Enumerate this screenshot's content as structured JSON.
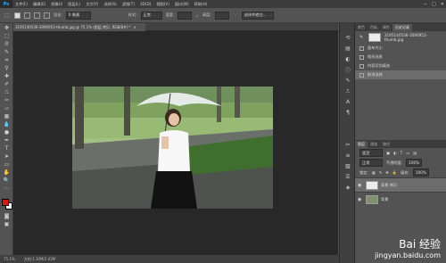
{
  "app": {
    "logo": "Ps",
    "menus": [
      "文件(F)",
      "编辑(E)",
      "图像(I)",
      "图层(L)",
      "文字(Y)",
      "选择(S)",
      "滤镜(T)",
      "3D(D)",
      "视图(V)",
      "窗口(W)",
      "帮助(H)"
    ],
    "window_controls": [
      "−",
      "□",
      "✕"
    ]
  },
  "options": {
    "feather_label": "羽化:",
    "feather_value": "0 像素",
    "style_label": "样式:",
    "style_value": "正常",
    "width_label": "宽度:",
    "height_label": "高度:",
    "select_mask": "选择并遮住..."
  },
  "document": {
    "tab_title": "3195140536-3090953-thumb.jpg @ 75.1% (图层 拷贝, RGB/8#) *",
    "close": "×",
    "zoom": "75.1%",
    "doc_info": "文档:1.10M/2.43M"
  },
  "panels": {
    "top_tabs": [
      "颜色",
      "色板",
      "属性",
      "历史记录"
    ],
    "history": [
      {
        "label": "3195140536-3090953-thumb.jpg",
        "selected": false,
        "snapshot": true
      },
      {
        "label": "画布大小",
        "selected": false
      },
      {
        "label": "矩形选框",
        "selected": false
      },
      {
        "label": "内容识别填充",
        "selected": false
      },
      {
        "label": "取消选择",
        "selected": true
      }
    ],
    "layer_tabs": [
      "图层",
      "通道",
      "路径"
    ],
    "layer_filter": "类型",
    "blend_mode": "正常",
    "opacity_label": "不透明度:",
    "opacity_value": "100%",
    "lock_label": "锁定:",
    "fill_label": "填充:",
    "fill_value": "100%",
    "layers": [
      {
        "name": "背景 拷贝",
        "selected": true
      },
      {
        "name": "背景",
        "selected": false
      }
    ]
  },
  "watermark": {
    "brand": "Bai 经验",
    "url": "jingyan.baidu.com"
  },
  "colors": {
    "foreground": "#e3150d",
    "background": "#ffffff"
  }
}
